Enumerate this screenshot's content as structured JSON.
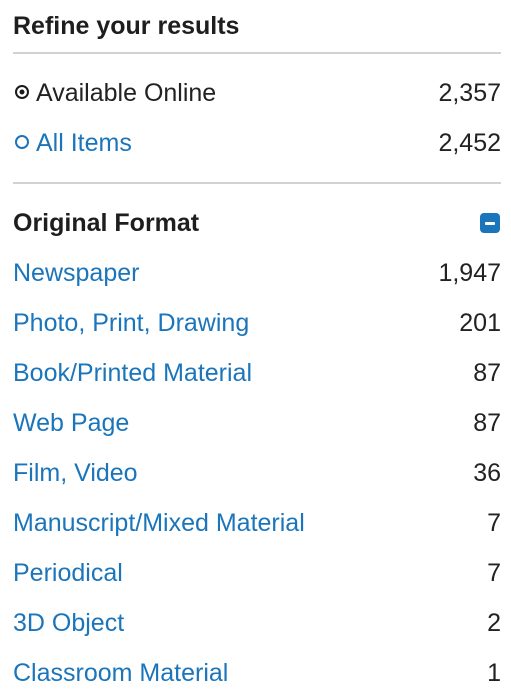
{
  "refine": {
    "title": "Refine your results"
  },
  "availability": [
    {
      "label": "Available Online",
      "count": "2,357",
      "selected": true
    },
    {
      "label": "All Items",
      "count": "2,452",
      "selected": false
    }
  ],
  "original_format": {
    "title": "Original Format",
    "toggle_icon": "minus-square-icon",
    "items": [
      {
        "label": "Newspaper",
        "count": "1,947"
      },
      {
        "label": "Photo, Print, Drawing",
        "count": "201"
      },
      {
        "label": "Book/Printed Material",
        "count": "87"
      },
      {
        "label": "Web Page",
        "count": "87"
      },
      {
        "label": "Film, Video",
        "count": "36"
      },
      {
        "label": "Manuscript/Mixed Material",
        "count": "7"
      },
      {
        "label": "Periodical",
        "count": "7"
      },
      {
        "label": "3D Object",
        "count": "2"
      },
      {
        "label": "Classroom Material",
        "count": "1"
      }
    ]
  },
  "colors": {
    "link": "#1b75bb",
    "text": "#222222",
    "divider": "#d2d2d2"
  }
}
